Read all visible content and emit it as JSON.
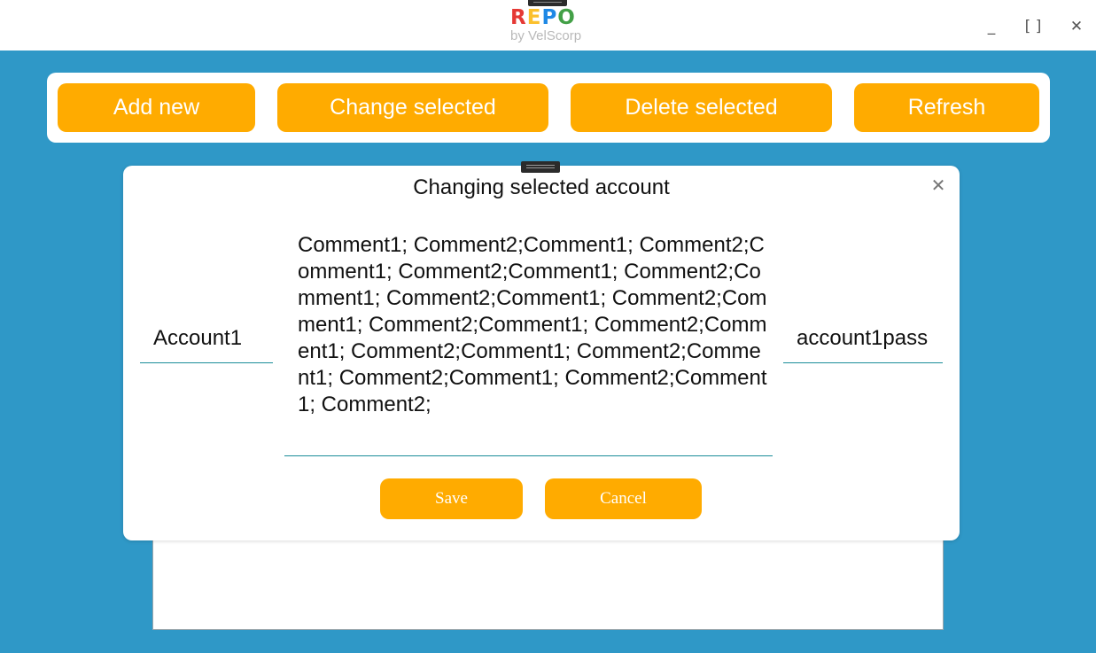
{
  "app": {
    "logo_text": "REPO",
    "logo_letters": [
      {
        "char": "R",
        "color": "#e53935"
      },
      {
        "char": "E",
        "color": "#fbc02d"
      },
      {
        "char": "P",
        "color": "#1e88e5"
      },
      {
        "char": "O",
        "color": "#43a047"
      }
    ],
    "logo_subtitle": "by VelScorp",
    "window_controls": {
      "minimize": "_",
      "maximize": "[ ]",
      "close": "✕"
    }
  },
  "toolbar": {
    "add_label": "Add new",
    "change_label": "Change selected",
    "delete_label": "Delete selected",
    "refresh_label": "Refresh"
  },
  "dialog": {
    "title": "Changing selected account",
    "close_icon": "✕",
    "account_value": "Account1",
    "comment_value": "Comment1; Comment2;Comment1; Comment2;Comment1; Comment2;Comment1; Comment2;Comment1; Comment2;Comment1; Comment2;Comment1; Comment2;Comment1; Comment2;Comment1; Comment2;Comment1; Comment2;Comment1; Comment2;Comment1; Comment2;Comment1; Comment2;",
    "password_value": "account1pass",
    "save_label": "Save",
    "cancel_label": "Cancel"
  },
  "colors": {
    "accent": "#ffab00",
    "background": "#2f98c7",
    "field_underline": "#1a8d99"
  }
}
